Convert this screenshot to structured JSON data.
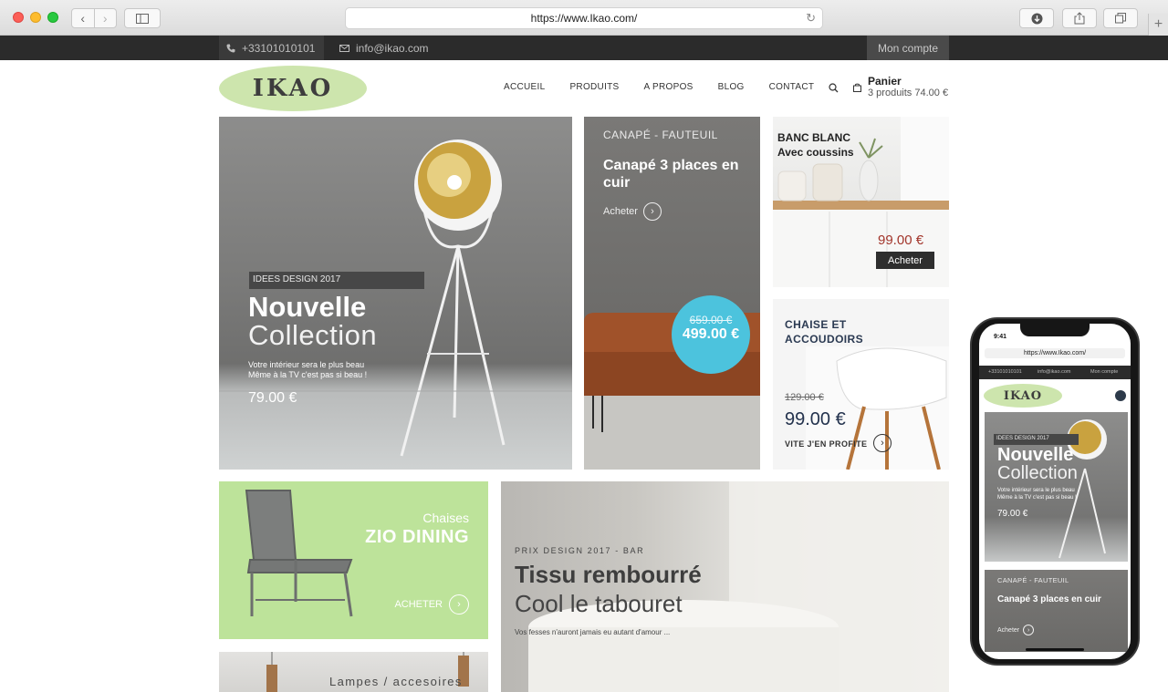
{
  "browser": {
    "url": "https://www.Ikao.com/"
  },
  "topbar": {
    "phone": "+33101010101",
    "email": "info@ikao.com",
    "account": "Mon compte"
  },
  "header": {
    "logo": "IKAO",
    "nav": [
      "ACCUEIL",
      "PRODUITS",
      "A PROPOS",
      "BLOG",
      "CONTACT"
    ],
    "cart_title": "Panier",
    "cart_summary": "3 produits 74.00 €"
  },
  "hero": {
    "tag": "IDEES DESIGN 2017",
    "title": "Nouvelle",
    "title2": "Collection",
    "desc_line1": "Votre intérieur sera le plus beau",
    "desc_line2": "Même à la TV c'est pas si beau !",
    "price": "79.00 €"
  },
  "sofa": {
    "category": "CANAPÉ - FAUTEUIL",
    "title": "Canapé 3 places en cuir",
    "buy": "Acheter",
    "old_price": "659.00 €",
    "new_price": "499.00 €"
  },
  "bench": {
    "title_line1": "BANC BLANC",
    "title_line2": "Avec coussins",
    "price": "99.00 €",
    "buy": "Acheter"
  },
  "chair": {
    "title_line1": "CHAISE ET",
    "title_line2": "ACCOUDOIRS",
    "old_price": "129.00 €",
    "new_price": "99.00 €",
    "cta": "VITE J'EN PROFITE"
  },
  "zio": {
    "subtitle": "Chaises",
    "title": "ZIO DINING",
    "buy": "ACHETER"
  },
  "stool": {
    "category": "PRIX DESIGN 2017 - BAR",
    "title": "Tissu rembourré",
    "subtitle": "Cool le tabouret",
    "desc": "Vos fesses n'auront jamais eu autant d'amour ..."
  },
  "lamps": {
    "title": "Lampes / accesoires"
  },
  "phone": {
    "time": "9:41",
    "url": "https://www.Ikao.com/",
    "topbar_phone": "+33101010101",
    "topbar_email": "info@ikao.com",
    "topbar_account": "Mon compte",
    "logo": "IKAO",
    "hero_tag": "IDEES DESIGN 2017",
    "hero_title": "Nouvelle",
    "hero_title2": "Collection",
    "hero_desc1": "Votre intérieur sera le plus beau",
    "hero_desc2": "Même à la TV c'est pas si beau !",
    "hero_price": "79.00 €",
    "sofa_category": "CANAPÉ - FAUTEUIL",
    "sofa_title": "Canapé 3 places en cuir",
    "sofa_buy": "Acheter"
  },
  "colors": {
    "accent_green": "#cde5ad",
    "price_bubble": "#4cc3dd",
    "topbar": "#2b2b2b",
    "bench_price": "#a2352b"
  }
}
